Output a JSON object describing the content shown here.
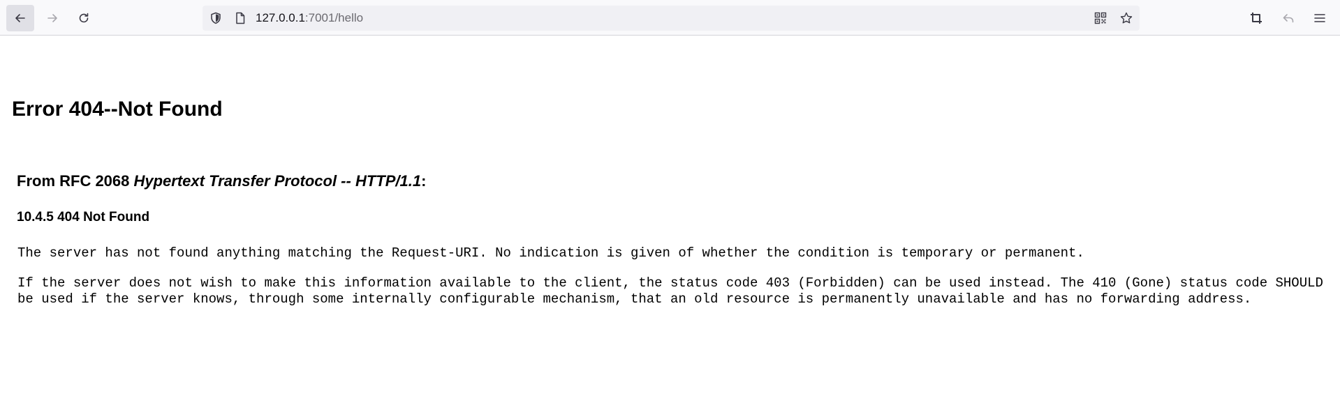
{
  "browser": {
    "url_host": "127.0.0.1",
    "url_rest": ":7001/hello",
    "icons": [
      "back-arrow-icon",
      "forward-arrow-icon",
      "reload-icon",
      "shield-icon",
      "page-icon",
      "qr-code-icon",
      "star-icon",
      "crop-icon",
      "undo-icon",
      "hamburger-menu-icon"
    ]
  },
  "page": {
    "error_title": "Error 404--Not Found",
    "section_prefix": "From RFC 2068 ",
    "section_italic": "Hypertext Transfer Protocol -- HTTP/1.1",
    "section_suffix": ":",
    "subsection": "10.4.5 404 Not Found",
    "paragraph1": "The server has not found anything matching the Request-URI. No indication is given of whether the condition is temporary or permanent.",
    "paragraph2": "If the server does not wish to make this information available to the client, the status code 403 (Forbidden) can be used instead. The 410 (Gone) status code SHOULD be used if the server knows, through some internally configurable mechanism, that an old resource is permanently unavailable and has no forwarding address."
  }
}
